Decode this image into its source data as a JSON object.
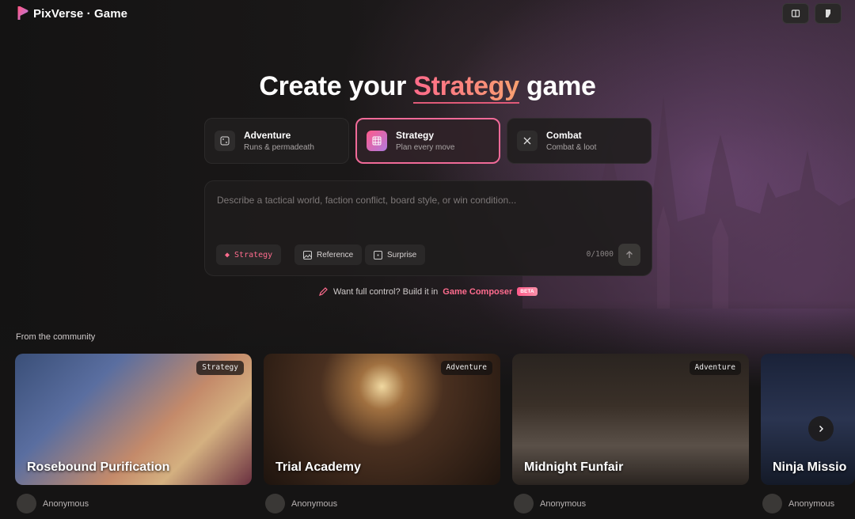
{
  "brand": {
    "name": "PixVerse · Game"
  },
  "header": {
    "icons": [
      "book-icon",
      "bookmark-icon"
    ]
  },
  "hero": {
    "prefix": "Create your",
    "highlight": "Strategy",
    "suffix": "game"
  },
  "modes": [
    {
      "title": "Adventure",
      "subtitle": "Runs & permadeath",
      "icon": "dice-icon"
    },
    {
      "title": "Strategy",
      "subtitle": "Plan every move",
      "icon": "grid-icon"
    },
    {
      "title": "Combat",
      "subtitle": "Combat & loot",
      "icon": "swords-icon"
    }
  ],
  "prompt": {
    "placeholder": "Describe a tactical world, faction conflict, board style, or win condition...",
    "chips": [
      "Strategy",
      "Reference",
      "Surprise"
    ],
    "counter": "0/1000"
  },
  "composer": {
    "text": "Want full control? Build it in",
    "link": "Game Composer",
    "badge": "BETA"
  },
  "community": {
    "heading": "From the community",
    "cards": [
      {
        "title": "Rosebound Purification",
        "tag": "Strategy",
        "author": "Anonymous"
      },
      {
        "title": "Trial Academy",
        "tag": "Adventure",
        "author": "Anonymous"
      },
      {
        "title": "Midnight Funfair",
        "tag": "Adventure",
        "author": "Anonymous"
      },
      {
        "title": "Ninja Missio",
        "tag": "",
        "author": "Anonymous"
      }
    ]
  },
  "colors": {
    "accent": "#f06a98",
    "background": "#151414"
  }
}
